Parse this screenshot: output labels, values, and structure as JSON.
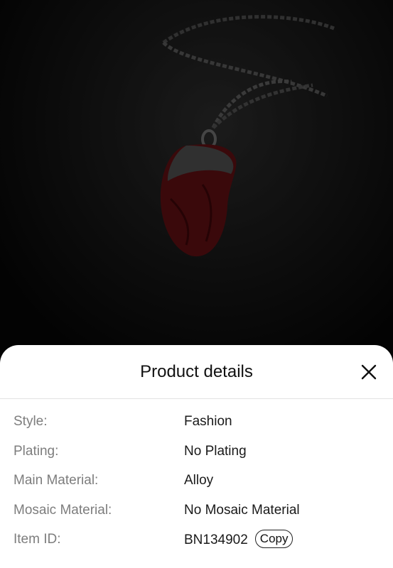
{
  "sheet": {
    "title": "Product details"
  },
  "details": [
    {
      "label": "Style:",
      "value": "Fashion"
    },
    {
      "label": "Plating:",
      "value": "No Plating"
    },
    {
      "label": "Main Material:",
      "value": "Alloy"
    },
    {
      "label": "Mosaic Material:",
      "value": "No Mosaic Material"
    },
    {
      "label": "Item ID:",
      "value": "BN134902"
    }
  ],
  "copy_button": {
    "label": "Copy"
  },
  "icons": {
    "close": "close-icon"
  }
}
